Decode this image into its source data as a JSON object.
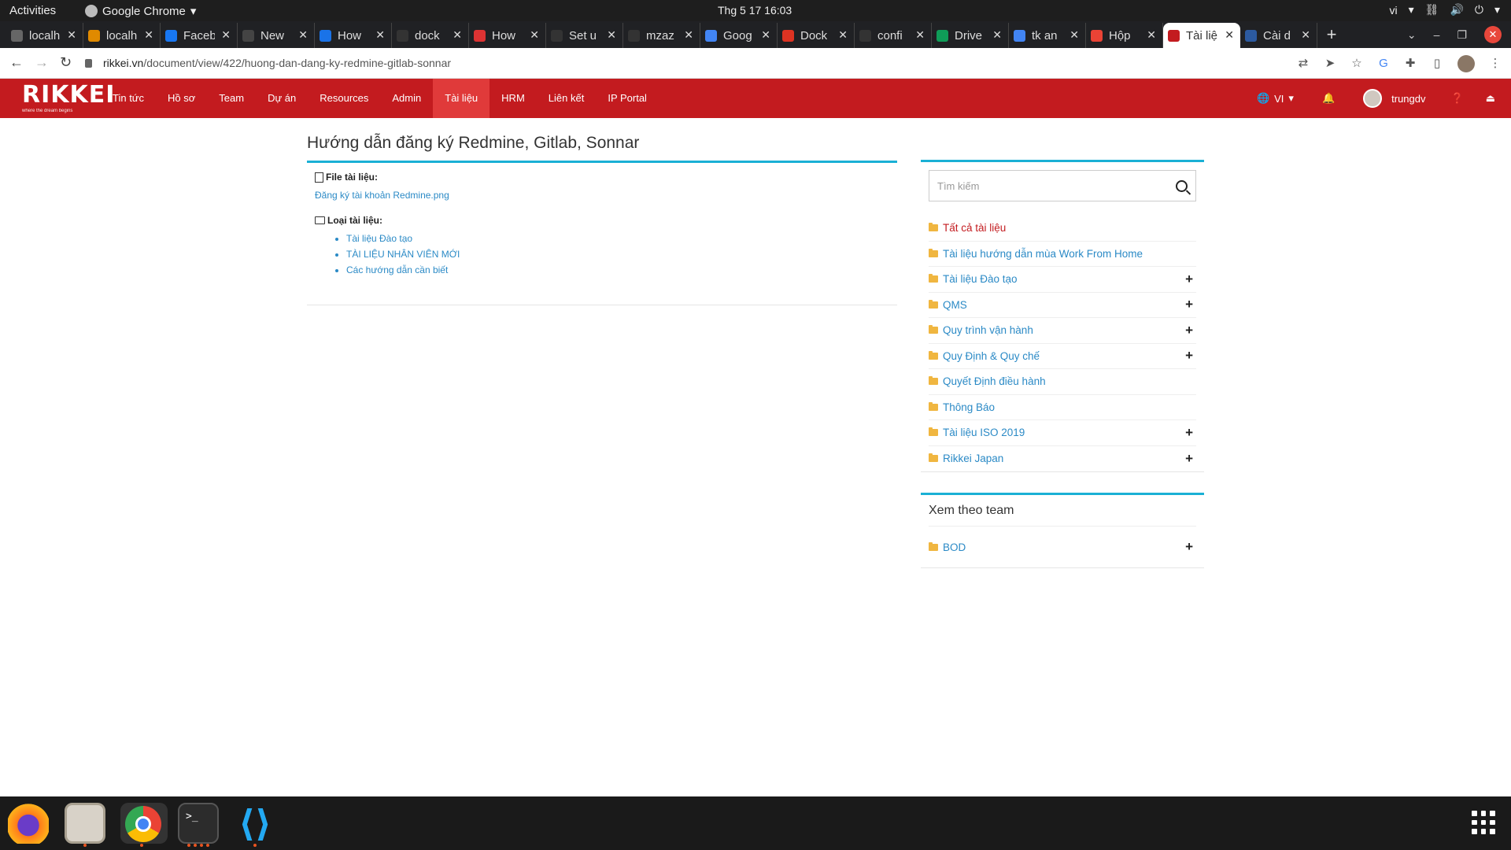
{
  "system": {
    "activities": "Activities",
    "app_name": "Google Chrome",
    "clock": "Thg 5 17  16:03",
    "lang": "vi"
  },
  "tabs": [
    {
      "label": "localh",
      "color": "#666"
    },
    {
      "label": "localh",
      "color": "#e08a00"
    },
    {
      "label": "Faceb",
      "color": "#1877f2"
    },
    {
      "label": "New",
      "color": "#444"
    },
    {
      "label": "How",
      "color": "#1a73e8"
    },
    {
      "label": "dock",
      "color": "#333"
    },
    {
      "label": "How",
      "color": "#d33"
    },
    {
      "label": "Set u",
      "color": "#333"
    },
    {
      "label": "mzaz",
      "color": "#333"
    },
    {
      "label": "Goog",
      "color": "#4285f4"
    },
    {
      "label": "Dock",
      "color": "#d32"
    },
    {
      "label": "confi",
      "color": "#333"
    },
    {
      "label": "Drive",
      "color": "#0f9d58"
    },
    {
      "label": "tk an",
      "color": "#4285f4"
    },
    {
      "label": "Hộp",
      "color": "#ea4335"
    },
    {
      "label": "Tài liệ",
      "color": "#c31b1f"
    },
    {
      "label": "Cài d",
      "color": "#2c5aa0"
    }
  ],
  "address": {
    "domain": "rikkei.vn",
    "path": "/document/view/422/huong-dan-dang-ky-redmine-gitlab-sonnar"
  },
  "navbar": {
    "logo_text": "RIKKEI",
    "logo_tagline": "where the dream begins",
    "menu": [
      "Tin tức",
      "Hồ sơ",
      "Team",
      "Dự án",
      "Resources",
      "Admin",
      "Tài liệu",
      "HRM",
      "Liên kết",
      "IP Portal"
    ],
    "active_index": 6,
    "lang": "VI",
    "username": "trungdv"
  },
  "document": {
    "title": "Hướng dẫn đăng ký Redmine, Gitlab, Sonnar",
    "file_label": "File tài liệu:",
    "file_name": "Đăng ký tài khoản Redmine.png",
    "type_label": "Loại tài liệu:",
    "types": [
      "Tài liệu Đào tạo",
      "TÀI LIỆU NHÂN VIÊN MỚI",
      "Các hướng dẫn cần biết"
    ]
  },
  "sidebar": {
    "search_placeholder": "Tìm kiếm",
    "categories": [
      {
        "label": "Tất cả tài liệu",
        "expandable": false,
        "highlight": true
      },
      {
        "label": "Tài liệu hướng dẫn mùa Work From Home",
        "expandable": false
      },
      {
        "label": "Tài liệu Đào tạo",
        "expandable": true
      },
      {
        "label": "QMS",
        "expandable": true
      },
      {
        "label": "Quy trình vận hành",
        "expandable": true
      },
      {
        "label": "Quy Định & Quy chế",
        "expandable": true
      },
      {
        "label": "Quyết Định điều hành",
        "expandable": false
      },
      {
        "label": "Thông Báo",
        "expandable": false
      },
      {
        "label": "Tài liệu ISO 2019",
        "expandable": true
      },
      {
        "label": "Rikkei Japan",
        "expandable": true
      }
    ],
    "team_title": "Xem theo team",
    "teams": [
      {
        "label": "BOD",
        "expandable": true
      }
    ]
  },
  "colors": {
    "brand": "#c31b1f",
    "accent": "#1ab0d5",
    "link": "#2b8ac6"
  }
}
